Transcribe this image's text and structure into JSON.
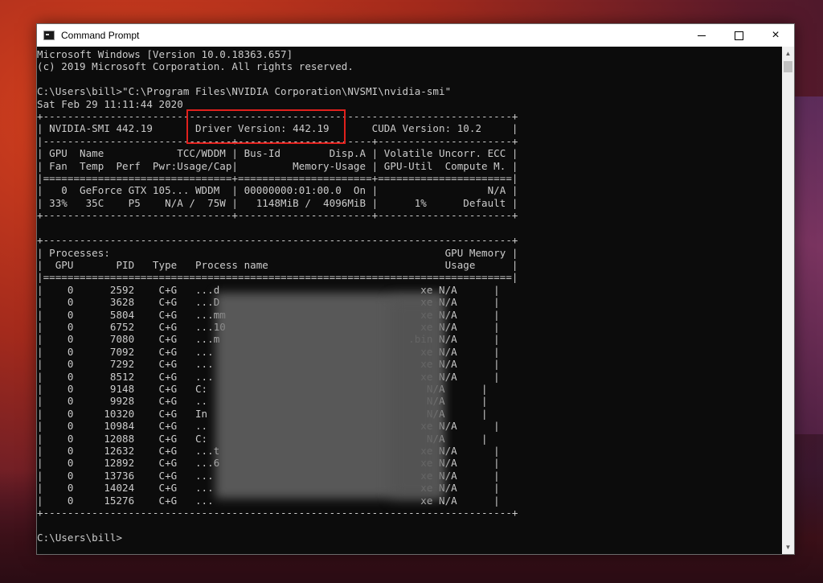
{
  "window": {
    "title": "Command Prompt",
    "icon": "cmd-icon",
    "controls": {
      "minimize": "minimize-icon",
      "maximize": "maximize-icon",
      "close": "×"
    }
  },
  "console": {
    "lines": [
      "Microsoft Windows [Version 10.0.18363.657]",
      "(c) 2019 Microsoft Corporation. All rights reserved.",
      "",
      "C:\\Users\\bill>\"C:\\Program Files\\NVIDIA Corporation\\NVSMI\\nvidia-smi\"",
      "Sat Feb 29 11:11:44 2020",
      "+-----------------------------------------------------------------------------+",
      "| NVIDIA-SMI 442.19       Driver Version: 442.19       CUDA Version: 10.2     |",
      "|-------------------------------+----------------------+----------------------+",
      "| GPU  Name            TCC/WDDM | Bus-Id        Disp.A | Volatile Uncorr. ECC |",
      "| Fan  Temp  Perf  Pwr:Usage/Cap|         Memory-Usage | GPU-Util  Compute M. |",
      "|===============================+======================+======================|",
      "|   0  GeForce GTX 105... WDDM  | 00000000:01:00.0  On |                  N/A |",
      "| 33%   35C    P5    N/A /  75W |   1148MiB /  4096MiB |      1%      Default |",
      "+-------------------------------+----------------------+----------------------+",
      "",
      "+-----------------------------------------------------------------------------+",
      "| Processes:                                                       GPU Memory |",
      "|  GPU       PID   Type   Process name                             Usage      |",
      "|=============================================================================|",
      "|    0      2592    C+G   ...d                                 xe N/A      |",
      "|    0      3628    C+G   ...D                                 xe N/A      |",
      "|    0      5804    C+G   ...mm                                xe N/A      |",
      "|    0      6752    C+G   ...10                                xe N/A      |",
      "|    0      7080    C+G   ...m                               .bin N/A      |",
      "|    0      7092    C+G   ...                                  xe N/A      |",
      "|    0      7292    C+G   ...                                  xe N/A      |",
      "|    0      8512    C+G   ...                                  xe N/A      |",
      "|    0      9148    C+G   C:                                    N/A      |",
      "|    0      9928    C+G   ..                                    N/A      |",
      "|    0     10320    C+G   In                                    N/A      |",
      "|    0     10984    C+G   ..                                   xe N/A      |",
      "|    0     12088    C+G   C:                                    N/A      |",
      "|    0     12632    C+G   ...t                                 xe N/A      |",
      "|    0     12892    C+G   ...6                                 xe N/A      |",
      "|    0     13736    C+G   ...                                  xe N/A      |",
      "|    0     14024    C+G   ...                                  xe N/A      |",
      "|    0     15276    C+G   ...                                  xe N/A      |",
      "+-----------------------------------------------------------------------------+",
      "",
      "C:\\Users\\bill>"
    ]
  },
  "annotation": {
    "highlight_color": "#e0201c"
  },
  "scrollbar": {
    "up": "▲",
    "down": "▼"
  }
}
